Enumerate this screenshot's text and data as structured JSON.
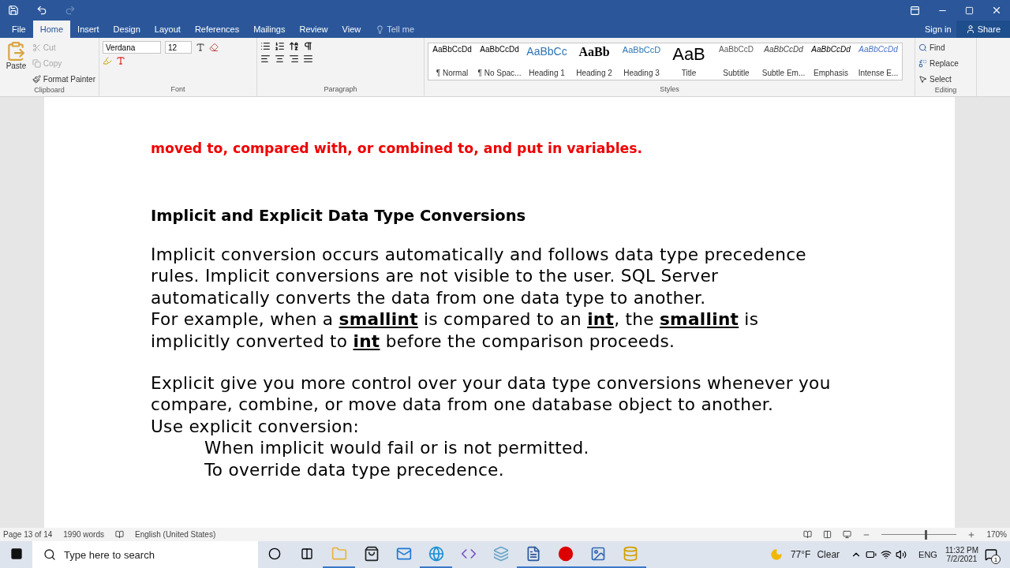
{
  "ribbon_tabs": [
    {
      "label": "File",
      "selected": false
    },
    {
      "label": "Home",
      "selected": true
    },
    {
      "label": "Insert",
      "selected": false
    },
    {
      "label": "Design",
      "selected": false
    },
    {
      "label": "Layout",
      "selected": false
    },
    {
      "label": "References",
      "selected": false
    },
    {
      "label": "Mailings",
      "selected": false
    },
    {
      "label": "Review",
      "selected": false
    },
    {
      "label": "View",
      "selected": false
    }
  ],
  "tell_me": {
    "placeholder": "Tell me"
  },
  "account": {
    "sign_in": "Sign in",
    "share": "Share"
  },
  "clipboard": {
    "paste": "Paste",
    "items": [
      {
        "label": "Cut",
        "disabled": true
      },
      {
        "label": "Copy",
        "disabled": true
      },
      {
        "label": "Format Painter",
        "disabled": false
      }
    ],
    "label": "Clipboard"
  },
  "font": {
    "name": "Verdana",
    "size": "12",
    "label": "Font"
  },
  "paragraph": {
    "label": "Paragraph"
  },
  "styles": {
    "items": [
      {
        "preview": "AaBbCcDd",
        "name": "¶ Normal",
        "kind": "normal"
      },
      {
        "preview": "AaBbCcDd",
        "name": "¶ No Spac...",
        "kind": "normal"
      },
      {
        "preview": "AaBbCc",
        "name": "Heading 1",
        "kind": "heading1"
      },
      {
        "preview": "AaBb",
        "name": "Heading 2",
        "kind": "heading2"
      },
      {
        "preview": "AaBbCcD",
        "name": "Heading 3",
        "kind": "heading3"
      },
      {
        "preview": "AaB",
        "name": "Title",
        "kind": "title"
      },
      {
        "preview": "AaBbCcD",
        "name": "Subtitle",
        "kind": "subtitle"
      },
      {
        "preview": "AaBbCcDd",
        "name": "Subtle Em...",
        "kind": "subtle"
      },
      {
        "preview": "AaBbCcDd",
        "name": "Emphasis",
        "kind": "emphasis"
      },
      {
        "preview": "AaBbCcDd",
        "name": "Intense E...",
        "kind": "intense"
      }
    ],
    "label": "Styles"
  },
  "editing": {
    "find": "Find",
    "replace": "Replace",
    "select": "Select",
    "label": "Editing"
  },
  "document": [
    {
      "kind": "note",
      "text": "moved to, compared with, or combined to, and put in variables."
    },
    {
      "kind": "heading",
      "text": "Implicit and Explicit Data Type Conversions"
    },
    {
      "kind": "body",
      "lines": [
        {
          "text": "Implicit conversion occurs automatically and follows data type precedence"
        },
        {
          "text": "rules. Implicit conversions are not visible to the user. SQL Server"
        },
        {
          "text": "automatically converts the data from one data type to another."
        },
        {
          "text": "For example, when a **smallint** is compared to an **int**, the **smallint** is"
        },
        {
          "text": "implicitly converted to **int** before the comparison proceeds."
        }
      ]
    },
    {
      "kind": "body",
      "lines": [
        {
          "text": "Explicit give you more control over your data type conversions whenever you"
        },
        {
          "text": "compare, combine, or move data from one database object to another."
        },
        {
          "text": "Use explicit conversion:",
          "children": [
            {
              "text": "When implicit would fail or is not permitted."
            },
            {
              "text": "To override data type precedence."
            }
          ]
        }
      ]
    }
  ],
  "status_bar": {
    "page": "Page 13 of 14",
    "words": "1990 words",
    "language": "English (United States)",
    "zoom": "170%",
    "level": 0.57
  },
  "taskbar": {
    "search_placeholder": "Type here to search",
    "apps": [
      {
        "kind": "explorer",
        "running": true
      },
      {
        "kind": "store",
        "running": false
      },
      {
        "kind": "mail",
        "running": false
      },
      {
        "kind": "edge",
        "running": true
      },
      {
        "kind": "studio",
        "running": false
      },
      {
        "kind": "tool",
        "running": false
      },
      {
        "kind": "word",
        "running": true
      },
      {
        "kind": "record",
        "running": true
      },
      {
        "kind": "photos",
        "running": true
      },
      {
        "kind": "data",
        "running": true
      }
    ],
    "temperature": "77°F",
    "weather": "Clear",
    "language": "ENG",
    "time": "11:32 PM",
    "date": "7/2/2021",
    "notifications": "1"
  }
}
